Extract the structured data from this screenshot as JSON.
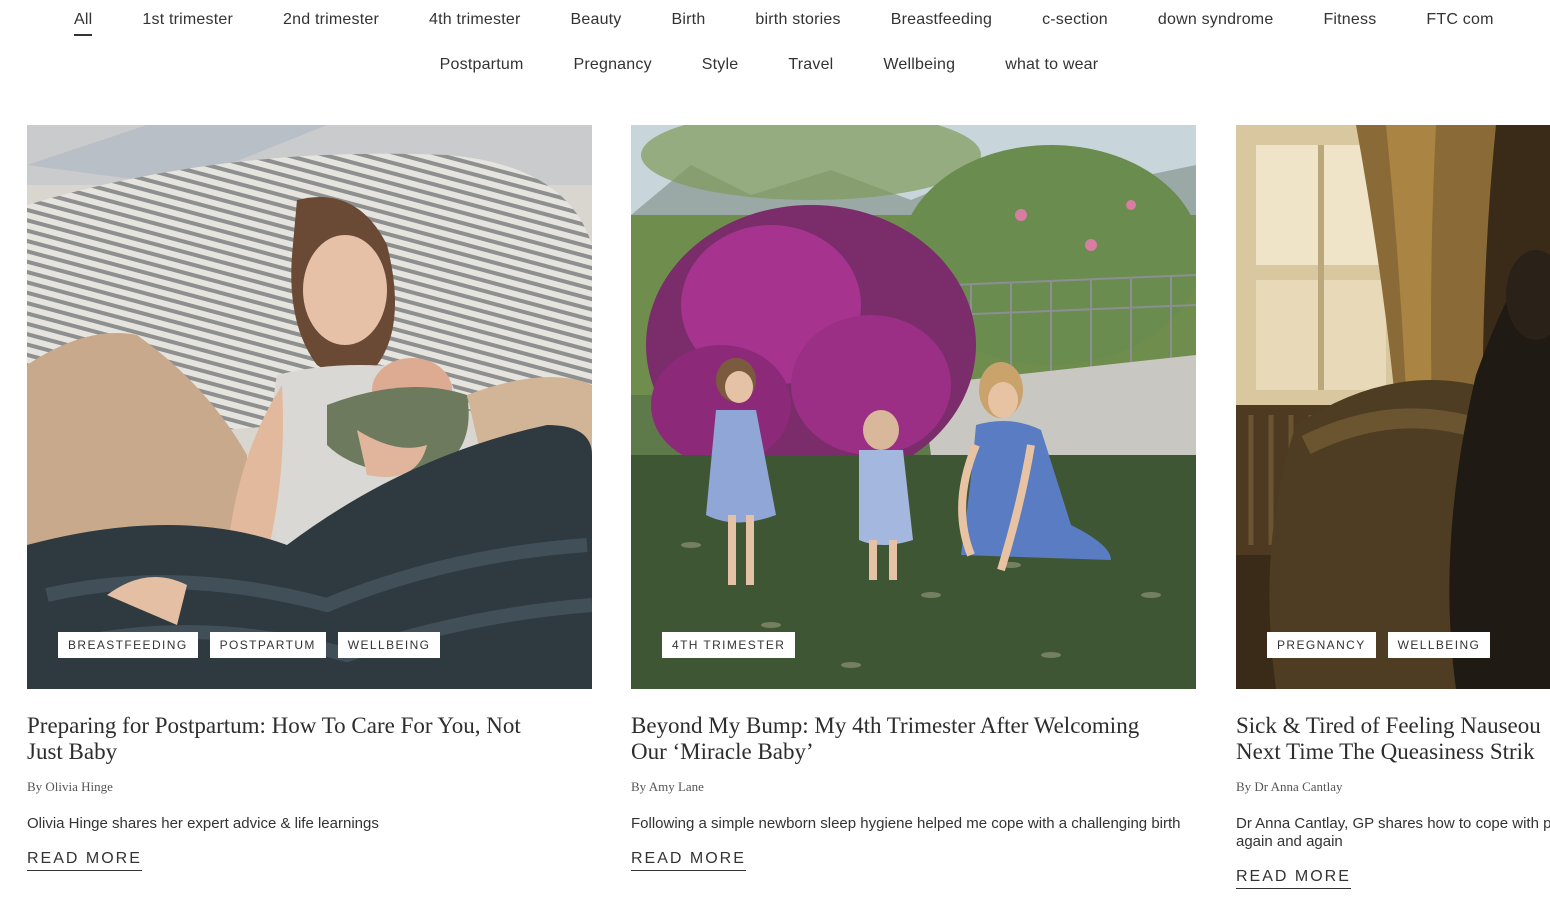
{
  "filters": {
    "row1": [
      "All",
      "1st trimester",
      "2nd trimester",
      "4th trimester",
      "Beauty",
      "Birth",
      "birth stories",
      "Breastfeeding",
      "c-section",
      "down syndrome",
      "Fitness",
      "FTC com"
    ],
    "row2": [
      "Postpartum",
      "Pregnancy",
      "Style",
      "Travel",
      "Wellbeing",
      "what to wear"
    ],
    "active": "All"
  },
  "posts": [
    {
      "title_lines": [
        "Preparing for Postpartum: How To Care For You, Not",
        "Just Baby"
      ],
      "author": "By Olivia Hinge",
      "excerpt_lines": [
        "Olivia Hinge shares her expert advice & life learnings"
      ],
      "tags": [
        "Breastfeeding",
        "Postpartum",
        "Wellbeing"
      ],
      "read_more": "READ MORE",
      "image": "mother-resting-with-newborn-photo"
    },
    {
      "title_lines": [
        "Beyond My Bump: My 4th Trimester After Welcoming",
        "Our ‘Miracle Baby’"
      ],
      "author": "By Amy Lane",
      "excerpt_lines": [
        "Following a simple newborn sleep hygiene helped me cope with a challenging birth"
      ],
      "tags": [
        "4th trimester"
      ],
      "read_more": "READ MORE",
      "image": "mother-and-children-in-garden-photo"
    },
    {
      "title_lines": [
        "Sick & Tired of Feeling Nauseou",
        "Next Time The Queasiness Strik"
      ],
      "author": "By Dr Anna Cantlay",
      "excerpt_lines": [
        "Dr Anna Cantlay, GP shares how to cope with p",
        "again and again"
      ],
      "tags": [
        "Pregnancy",
        "Wellbeing"
      ],
      "read_more": "READ MORE",
      "image": "woman-in-armchair-by-window-photo"
    }
  ],
  "colors": {
    "text": "#333333",
    "background": "#ffffff",
    "tag_background": "#ffffff"
  }
}
